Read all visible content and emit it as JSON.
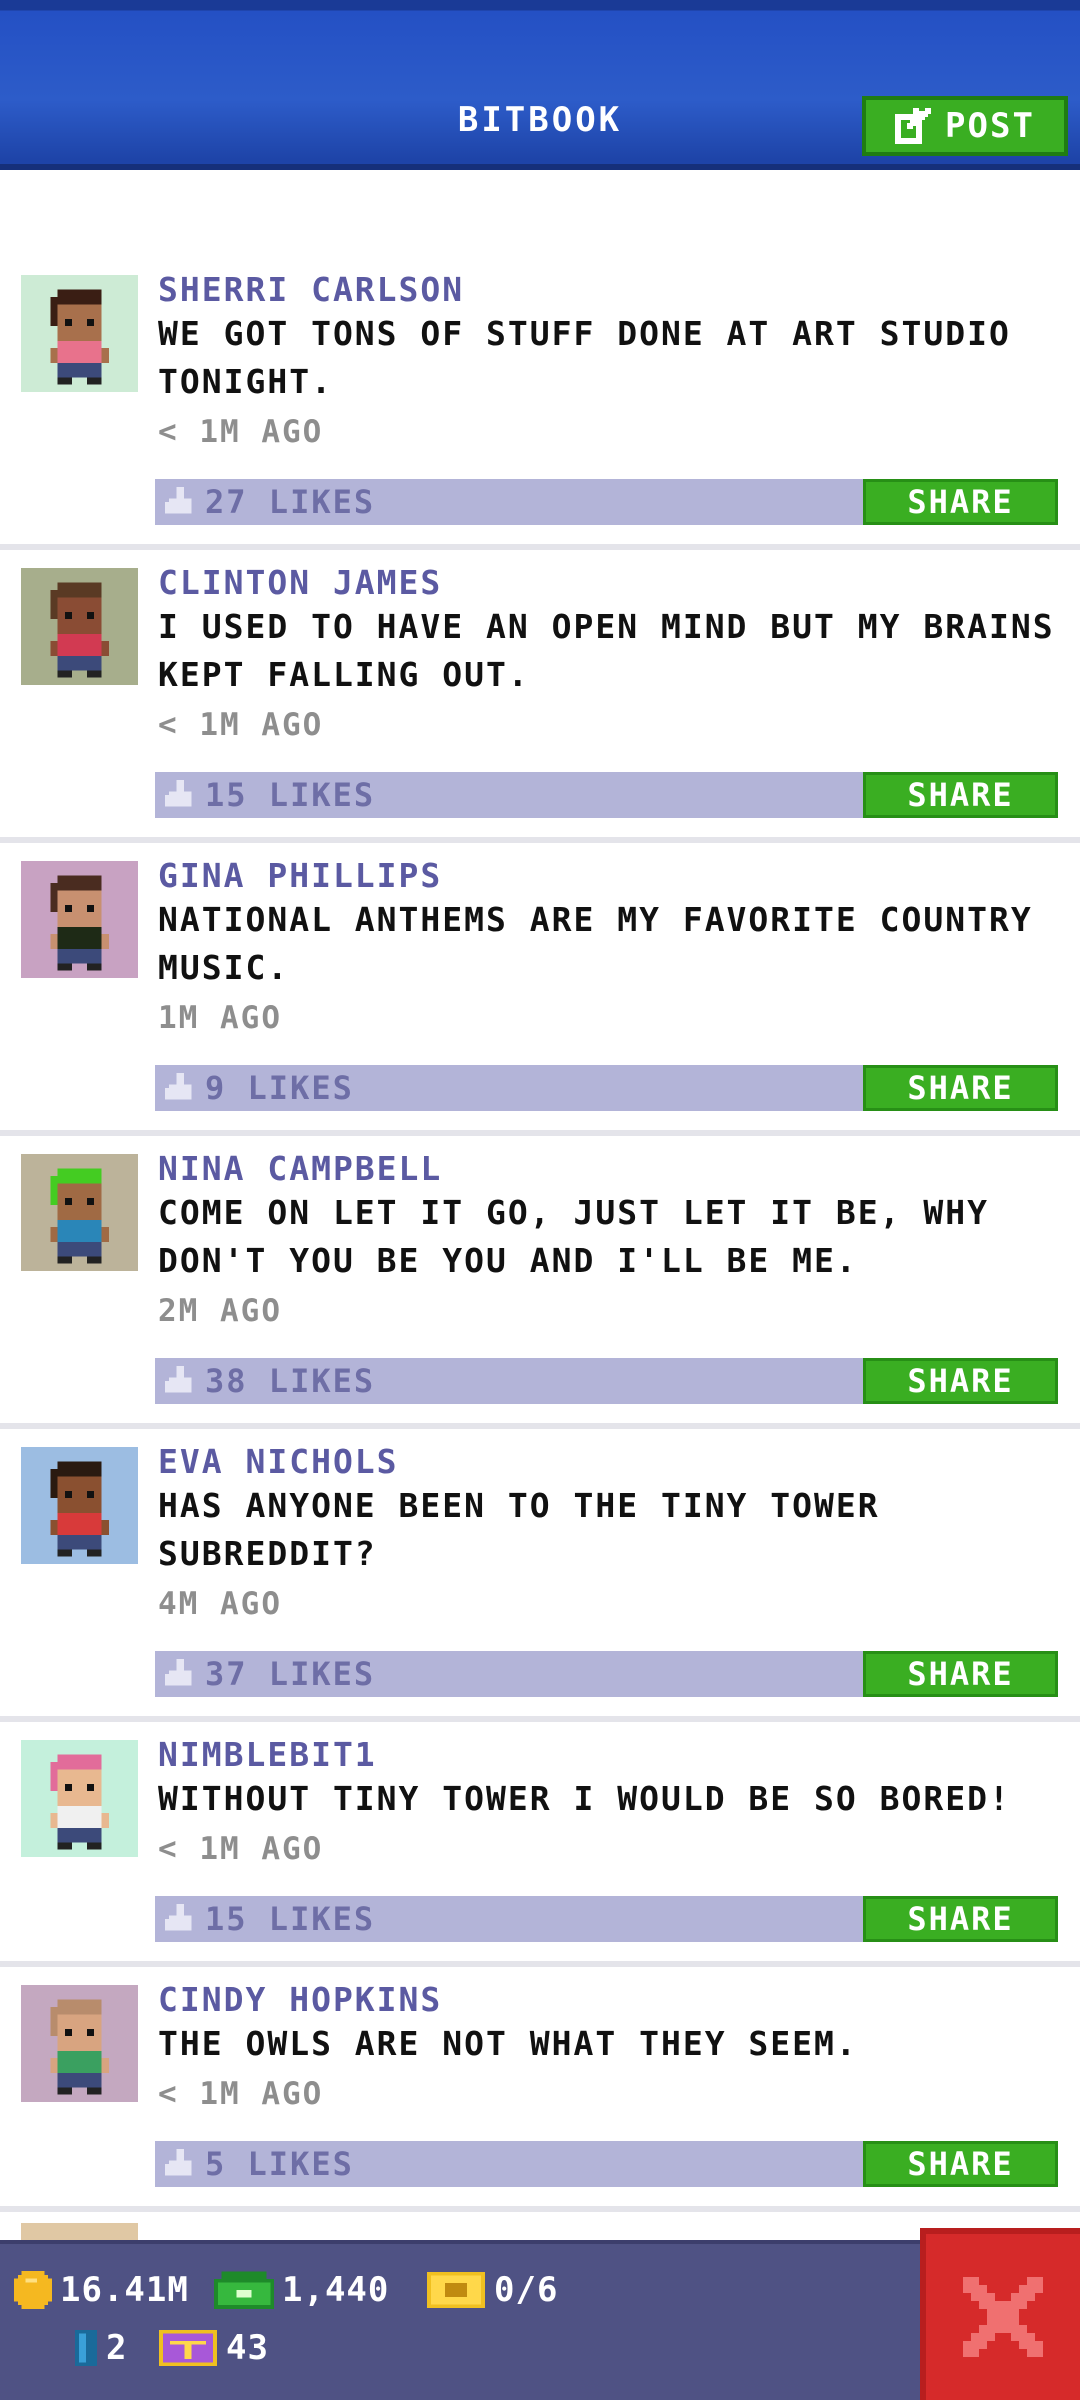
{
  "header": {
    "title": "BITBOOK",
    "post_label": "POST"
  },
  "posts": [
    {
      "author": "SHERRI CARLSON",
      "message": "WE GOT TONS OF STUFF DONE AT ART STUDIO TONIGHT.",
      "time": "< 1M AGO",
      "likes": "27 LIKES",
      "share_label": "SHARE",
      "avatar_bg": "#cdebd5",
      "shirt": "#e8728c",
      "skin": "#a8704c",
      "hair": "#3a1e14"
    },
    {
      "author": "CLINTON JAMES",
      "message": "I USED TO HAVE AN OPEN MIND BUT MY BRAINS KEPT FALLING OUT.",
      "time": "< 1M AGO",
      "likes": "15 LIKES",
      "share_label": "SHARE",
      "avatar_bg": "#a7ae8c",
      "shirt": "#d23a52",
      "skin": "#8a4c34",
      "hair": "#5a3a24"
    },
    {
      "author": "GINA PHILLIPS",
      "message": "NATIONAL ANTHEMS ARE MY FAVORITE COUNTRY MUSIC.",
      "time": "1M AGO",
      "likes": "9 LIKES",
      "share_label": "SHARE",
      "avatar_bg": "#c8a2c2",
      "shirt": "#1e2a16",
      "skin": "#c89070",
      "hair": "#4a2c20"
    },
    {
      "author": "NINA CAMPBELL",
      "message": "COME ON LET IT GO, JUST LET IT BE, WHY DON'T YOU BE YOU AND I'LL BE ME.",
      "time": "2M AGO",
      "likes": "38 LIKES",
      "share_label": "SHARE",
      "avatar_bg": "#bcb39a",
      "shirt": "#2a86b8",
      "skin": "#a06a44",
      "hair": "#44cc22"
    },
    {
      "author": "EVA NICHOLS",
      "message": "HAS ANYONE BEEN TO THE TINY TOWER SUBREDDIT?",
      "time": "4M AGO",
      "likes": "37 LIKES",
      "share_label": "SHARE",
      "avatar_bg": "#9cbde2",
      "shirt": "#d83a3a",
      "skin": "#8a5030",
      "hair": "#2a1a10"
    },
    {
      "author": "NIMBLEBIT1",
      "message": "WITHOUT TINY TOWER I WOULD BE SO BORED!",
      "time": "< 1M AGO",
      "likes": "15 LIKES",
      "share_label": "SHARE",
      "avatar_bg": "#c4f0dc",
      "shirt": "#f0f0f0",
      "skin": "#e8b890",
      "hair": "#e26c9a"
    },
    {
      "author": "CINDY HOPKINS",
      "message": "THE OWLS ARE NOT WHAT THEY SEEM.",
      "time": "< 1M AGO",
      "likes": "5 LIKES",
      "share_label": "SHARE",
      "avatar_bg": "#c4a8c0",
      "shirt": "#3aa060",
      "skin": "#d8a480",
      "hair": "#b88c6c"
    }
  ],
  "statusbar": {
    "coins": "16.41M",
    "bux": "1,440",
    "tickets": "0/6",
    "keys": "2",
    "tower_tickets": "43"
  },
  "colors": {
    "header_blue": "#2d5cc9",
    "button_green": "#3aae22",
    "like_bar": "#b3b4d8",
    "author_purple": "#5b5aa2",
    "status_bar": "#4f5284",
    "close_red": "#d62a2a"
  }
}
